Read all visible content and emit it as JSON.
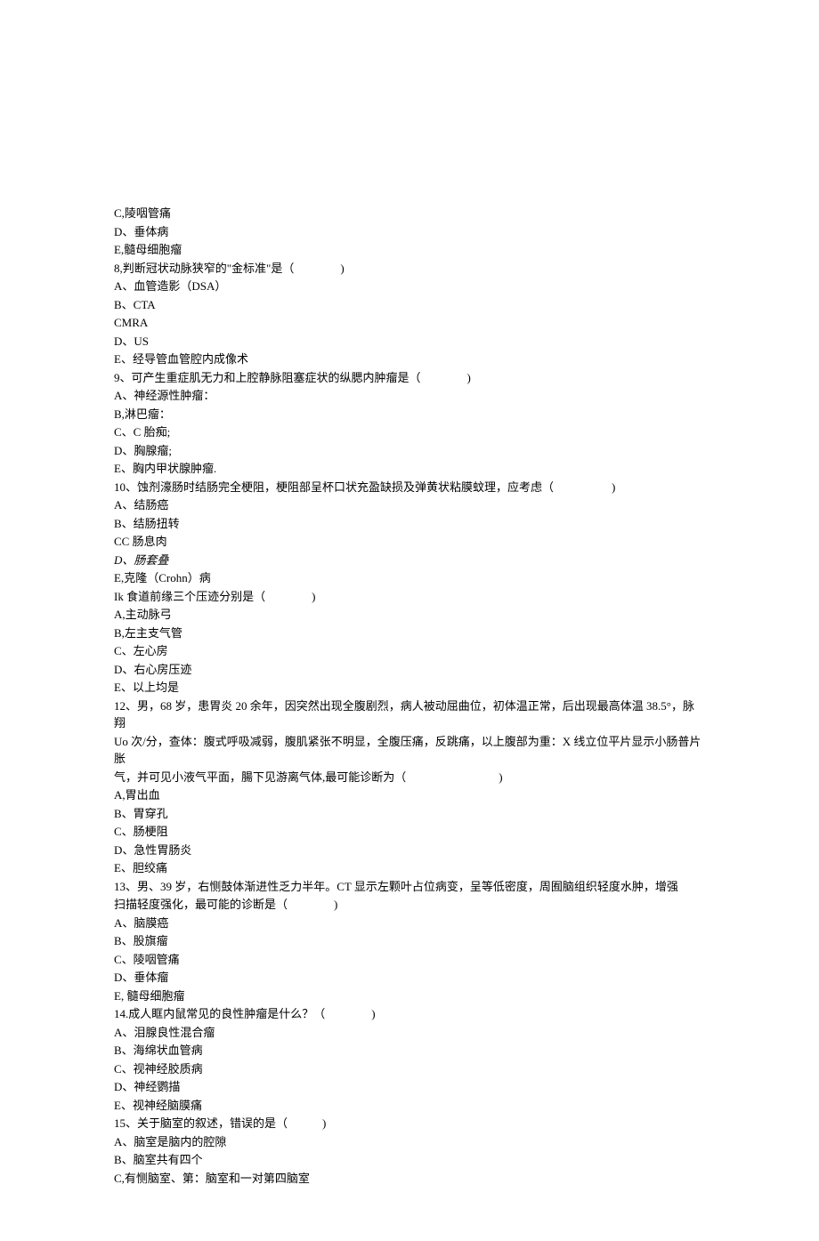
{
  "lines": [
    {
      "text": "C,陵咽管痛"
    },
    {
      "text": "D、垂体病"
    },
    {
      "text": "E,髓母细胞瘤"
    },
    {
      "text": "8,判断冠状动脉狭窄的\"金标准\"是（　　　　)"
    },
    {
      "text": "A、血管造影（DSA）"
    },
    {
      "text": "B、CTA"
    },
    {
      "text": "CMRA"
    },
    {
      "text": "D、US"
    },
    {
      "text": "E、经导管血管腔内成像术"
    },
    {
      "text": "9、可产生重症肌无力和上腔静脉阻塞症状的纵腮内肿瘤是（　　　　)"
    },
    {
      "text": "A、神经源性肿瘤："
    },
    {
      "text": "B,淋巴瘤："
    },
    {
      "text": "C、C 胎痴;"
    },
    {
      "text": "D、胸腺瘤;"
    },
    {
      "text": "E、胸内甲状腺肿瘤."
    },
    {
      "text": "10、蚀剂濠肠时结肠完全梗阻，梗阻部呈杯口状充盈缺损及弹黄状粘膜蚊理，应考虑（　　　　　)"
    },
    {
      "text": "A、结肠癌"
    },
    {
      "text": "B、结肠扭转"
    },
    {
      "text": "CC 肠息肉"
    },
    {
      "text": "D、肠套叠",
      "italic": true
    },
    {
      "text": "E,克隆（Crohn）病"
    },
    {
      "text": "Ik 食道前缘三个压迹分别是（　　　　)"
    },
    {
      "text": "A,主动脉弓"
    },
    {
      "text": "B,左主支气管"
    },
    {
      "text": "C、左心房"
    },
    {
      "text": "D、右心房压迹"
    },
    {
      "text": "E、以上均是"
    },
    {
      "text": "12、男，68 岁，患胃炎 20 余年，因突然出现全腹剧烈，病人被动屈曲位，初体温正常，后出现最高体温 38.5°，脉翔"
    },
    {
      "text": "Uo 次/分，查体：腹式呼吸减弱，腹肌紧张不明显，全腹压痛，反跳痛，以上腹部为重：X 线立位平片显示小肠普片胀"
    },
    {
      "text": "气，并可见小液气平面，腸下见游离气体,最可能诊断为（　　　　　　　　)"
    },
    {
      "text": "A,胃出血"
    },
    {
      "text": "B、胃穿孔"
    },
    {
      "text": "C、肠梗阻"
    },
    {
      "text": "D、急性胃肠炎"
    },
    {
      "text": "E、胆绞痛"
    },
    {
      "text": "13、男、39 岁，右恻鼓体渐进性乏力半年。CT 显示左颗叶占位病变，呈等低密度，周囿脑组织轻度水肿，增强"
    },
    {
      "text": "扫描轻度强化，最可能的诊断是（　　　　)"
    },
    {
      "text": "A、脑膜癌"
    },
    {
      "text": "B、股旗瘤"
    },
    {
      "text": "C、陵咽管痛"
    },
    {
      "text": "D、垂体瘤"
    },
    {
      "text": "E, 髓母细胞瘤"
    },
    {
      "text": "14.成人眶内鼠常见的良性肿瘤是什么？（　　　　)"
    },
    {
      "text": "A、泪腺良性混合瘤"
    },
    {
      "text": "B、海绵状血管病"
    },
    {
      "text": "C、视神经胶质病"
    },
    {
      "text": "D、神经鹦描"
    },
    {
      "text": "E、视神经脑膜痛"
    },
    {
      "text": "15、关于脑室的叙述，错误的是（　　　)"
    },
    {
      "text": "A、脑室是脑内的腔隙"
    },
    {
      "text": "B、脑室共有四个"
    },
    {
      "text": "C,有恻脑室、第：脑室和一对第四脑室"
    }
  ]
}
